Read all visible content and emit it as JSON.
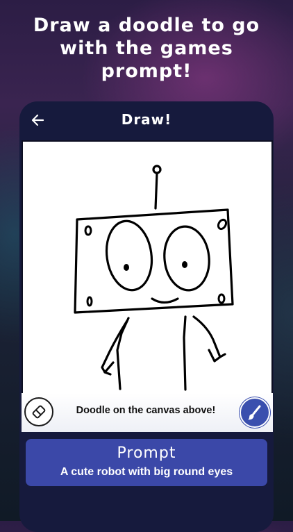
{
  "headline": {
    "line1": "Draw a doodle to go",
    "line2": "with the games",
    "line3": "prompt!"
  },
  "appbar": {
    "title": "Draw!",
    "back_icon": "arrow-left-icon"
  },
  "canvas": {
    "drawing": "robot doodle"
  },
  "toolbar": {
    "eraser_icon": "eraser-icon",
    "hint": "Doodle on the canvas above!",
    "brush_icon": "paintbrush-icon"
  },
  "prompt": {
    "title": "Prompt",
    "text": "A cute robot with big round eyes"
  },
  "colors": {
    "app_background": "#161a3d",
    "prompt_card": "#3b48a8",
    "brush_button": "#3a4fae",
    "canvas": "#ffffff",
    "ink": "#000000"
  }
}
